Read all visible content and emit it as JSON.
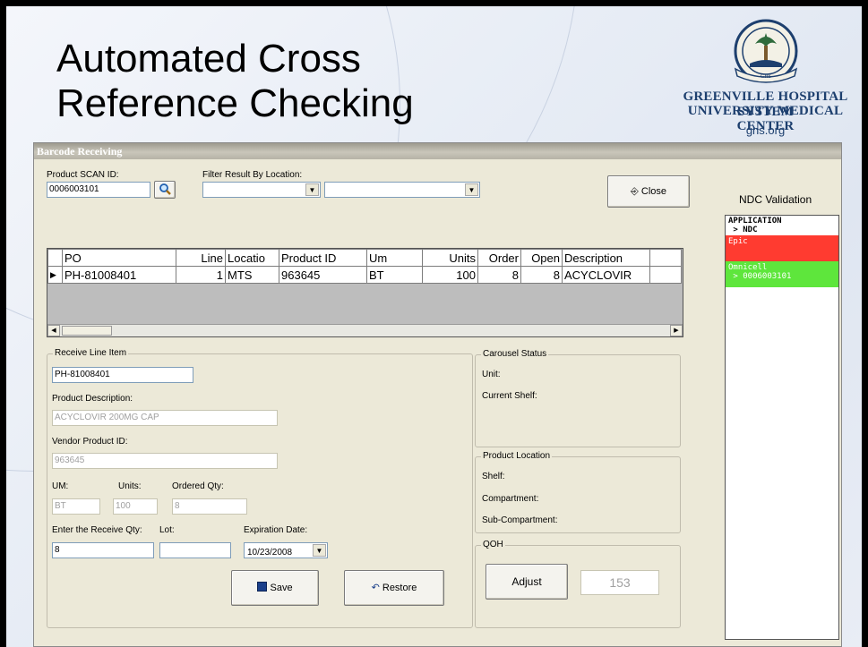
{
  "slide": {
    "title": "Automated Cross\nReference Checking",
    "logo": {
      "seal_text": "GHS",
      "line1": "GREENVILLE HOSPITAL SYSTEM",
      "line2": "UNIVERSITY MEDICAL CENTER",
      "url": "ghs.org"
    }
  },
  "window": {
    "title": "Barcode Receiving"
  },
  "scan": {
    "label": "Product SCAN ID:",
    "value": "0006003101",
    "filter_label": "Filter Result By Location:"
  },
  "close_label": "Close",
  "grid": {
    "columns": [
      "PO",
      "Line",
      "Locatio",
      "Product ID",
      "Um",
      "Units",
      "Order",
      "Open",
      "Description"
    ],
    "rows": [
      [
        "PH-81008401",
        "1",
        "MTS",
        "963645",
        "BT",
        "100",
        "8",
        "8",
        "ACYCLOVIR"
      ]
    ]
  },
  "receive": {
    "group_title": "Receive Line Item",
    "po_value": "PH-81008401",
    "desc_label": "Product Description:",
    "desc_value": "ACYCLOVIR 200MG CAP",
    "vendor_label": "Vendor Product ID:",
    "vendor_value": "963645",
    "um_label": "UM:",
    "um_value": "BT",
    "units_label": "Units:",
    "units_value": "100",
    "ordered_label": "Ordered Qty:",
    "ordered_value": "8",
    "receive_qty_label": "Enter the Receive Qty:",
    "receive_qty_value": "8",
    "lot_label": "Lot:",
    "lot_value": "",
    "exp_label": "Expiration Date:",
    "exp_value": "10/23/2008",
    "save_label": "Save",
    "restore_label": "Restore"
  },
  "carousel": {
    "title": "Carousel Status",
    "unit_label": "Unit:",
    "shelf_label": "Current Shelf:"
  },
  "location": {
    "title": "Product Location",
    "shelf_label": "Shelf:",
    "compartment_label": "Compartment:",
    "sub_label": "Sub-Compartment:"
  },
  "qoh": {
    "title": "QOH",
    "adjust_label": "Adjust",
    "value": "153"
  },
  "ndc": {
    "title": "NDC Validation",
    "header_line1": "APPLICATION",
    "header_line2": " > NDC",
    "epic": "Epic",
    "omnicell_line1": "Omnicell",
    "omnicell_line2": " > 0006003101",
    "colors": {
      "epic": "#ff3b30",
      "omnicell": "#5ee63c"
    }
  }
}
